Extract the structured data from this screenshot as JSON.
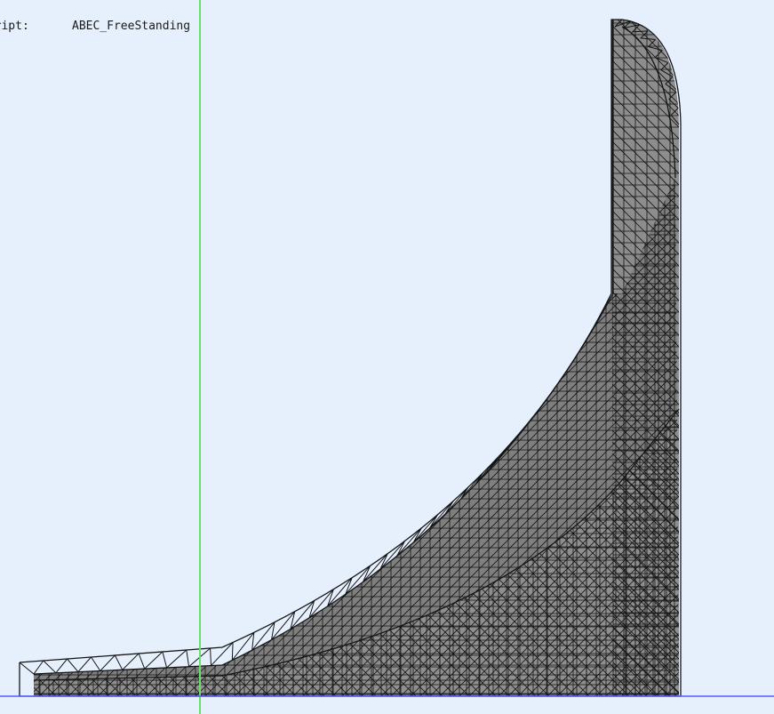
{
  "viewport": {
    "info": {
      "label": "Script:",
      "value": "ABEC_FreeStanding"
    },
    "colors": {
      "background": "#e6f0fd",
      "axis_vertical": "#66e266",
      "axis_horizontal": "#5a5aff",
      "mesh_fill": "#8d8d8d",
      "mesh_fill_dark": "#6e6e6e",
      "mesh_lines": "#151515"
    },
    "axes": [
      "vertical-axis",
      "horizontal-axis"
    ],
    "mesh": {
      "element_type": "triangle",
      "render_mode": "wireframe-over-solid"
    }
  }
}
